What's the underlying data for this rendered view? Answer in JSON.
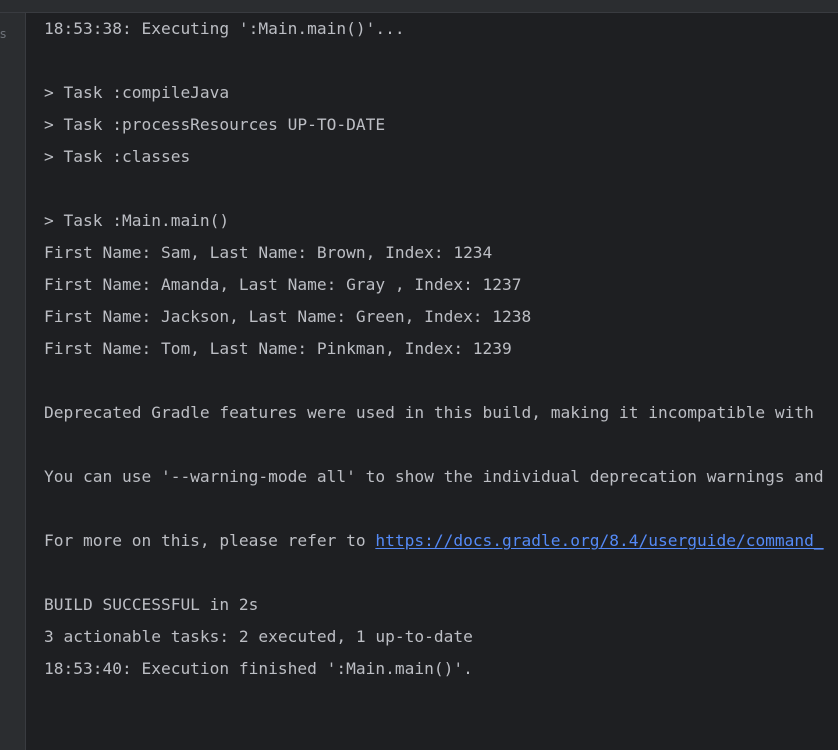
{
  "gutter": {
    "label": "s"
  },
  "console": {
    "lines": [
      "18:53:38: Executing ':Main.main()'...",
      "",
      "> Task :compileJava",
      "> Task :processResources UP-TO-DATE",
      "> Task :classes",
      "",
      "> Task :Main.main()",
      "First Name: Sam, Last Name: Brown, Index: 1234",
      "First Name: Amanda, Last Name: Gray , Index: 1237",
      "First Name: Jackson, Last Name: Green, Index: 1238",
      "First Name: Tom, Last Name: Pinkman, Index: 1239",
      "",
      "Deprecated Gradle features were used in this build, making it incompatible with",
      "",
      "You can use '--warning-mode all' to show the individual deprecation warnings and",
      "",
      "For more on this, please refer to ",
      "",
      "BUILD SUCCESSFUL in 2s",
      "3 actionable tasks: 2 executed, 1 up-to-date",
      "18:53:40: Execution finished ':Main.main()'."
    ],
    "link_text": "https://docs.gradle.org/8.4/userguide/command_"
  }
}
